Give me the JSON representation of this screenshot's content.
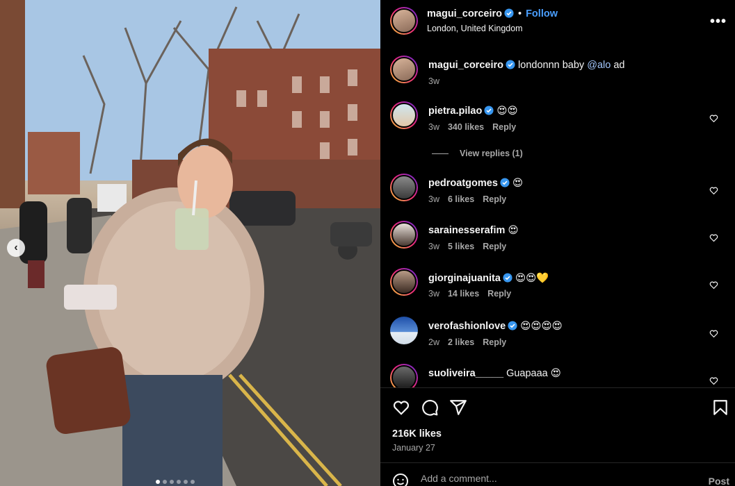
{
  "post": {
    "author": "magui_corceiro",
    "follow_label": "Follow",
    "separator": "•",
    "location": "London, United Kingdom",
    "more_label": "•••",
    "caption": {
      "username": "magui_corceiro",
      "text": "londonnn baby",
      "mention": "@alo",
      "suffix": "ad",
      "time": "3w"
    },
    "likes": "216K likes",
    "date": "January 27"
  },
  "comments": [
    {
      "username": "pietra.pilao",
      "verified": true,
      "text": "😍😍",
      "time": "3w",
      "likes": "340 likes",
      "reply": "Reply",
      "view_replies": "View replies (1)"
    },
    {
      "username": "pedroatgomes",
      "verified": true,
      "text": "😍",
      "time": "3w",
      "likes": "6 likes",
      "reply": "Reply"
    },
    {
      "username": "sarainesserafim",
      "verified": false,
      "text": "😍",
      "time": "3w",
      "likes": "5 likes",
      "reply": "Reply"
    },
    {
      "username": "giorginajuanita",
      "verified": true,
      "text": "😍😍💛",
      "time": "3w",
      "likes": "14 likes",
      "reply": "Reply"
    },
    {
      "username": "verofashionlove",
      "verified": true,
      "text": "😍😍😍😍",
      "time": "2w",
      "likes": "2 likes",
      "reply": "Reply"
    },
    {
      "username": "suoliveira_____",
      "verified": false,
      "text": "Guapaaa 😍",
      "time": "",
      "likes": "",
      "reply": ""
    }
  ],
  "add_comment": {
    "placeholder": "Add a comment...",
    "post_label": "Post"
  },
  "carousel": {
    "prev_glyph": "‹",
    "dots_total": 6,
    "dots_active": 1
  },
  "icons": {
    "like": "heart-icon",
    "comment": "comment-icon",
    "share": "share-icon",
    "save": "bookmark-icon",
    "verified": "verified-badge-icon",
    "emoji": "emoji-icon"
  },
  "colors": {
    "accent": "#4a9fff",
    "mention": "#a3c8ff",
    "muted": "#a8a8a8",
    "verified": "#3897f0"
  }
}
